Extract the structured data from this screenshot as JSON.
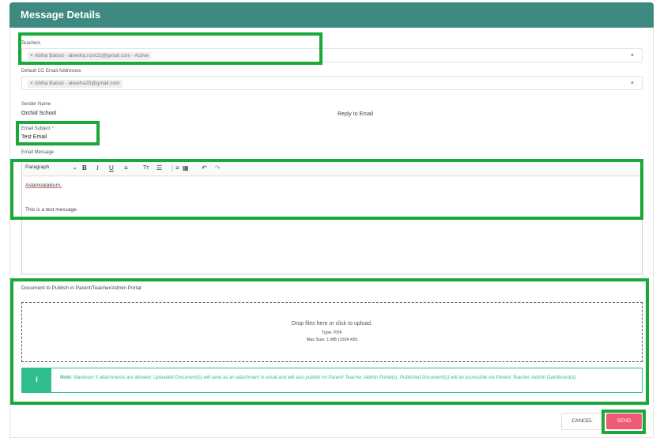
{
  "header": {
    "title": "Message Details"
  },
  "teachers": {
    "label": "Teachers",
    "tag": "Abiha Batool - abeeha.rizvi22@gmail.com - Active",
    "tag_remove": "×",
    "clear": "×"
  },
  "cc": {
    "label": "Default CC Email Addresses",
    "tag": "Abiha Batool - abeeha25@gmail.com",
    "tag_remove": "×",
    "clear": "×"
  },
  "sender": {
    "label": "Sender Name",
    "value": "Orchid School"
  },
  "reply": {
    "label": "Reply to Email"
  },
  "subject": {
    "label": "Email Subject",
    "required_mark": "*",
    "value": "Test Email"
  },
  "message": {
    "label": "Email Message",
    "toolbar": {
      "format": "Paragraph",
      "chevron": "⌄",
      "bold": "B",
      "italic": "I",
      "underline": "U",
      "align": "≡",
      "text_size": "Tт",
      "bullet_list": "☰",
      "numbered_list": "⋮≡",
      "table": "▦",
      "undo": "↶",
      "redo": "↷"
    },
    "line1": "Aslamoalaikum,",
    "line2": "This is a test message."
  },
  "document": {
    "label": "Document to Publish in Parent/Teacher/Admin Portal",
    "drop_main": "Drop files here or click to upload.",
    "drop_type": "Type: PDF",
    "drop_size": "Max Size: 1 MB (1024 KB)"
  },
  "note": {
    "prefix": "Note:",
    "text": "Maximum 5 attachments are allowed. Uploaded Document(s) will send as an attachment in email and will also publish on Parent/ Teacher /Admin Portal(s). Published Document(s) will be accessible via Parent/ Teacher /Admin Dashboard(s)."
  },
  "buttons": {
    "cancel": "CANCEL",
    "send": "SEND"
  },
  "colors": {
    "header": "#3f8a80",
    "highlight": "#1aa83a",
    "note": "#2fbf8f",
    "send": "#f05a78"
  }
}
